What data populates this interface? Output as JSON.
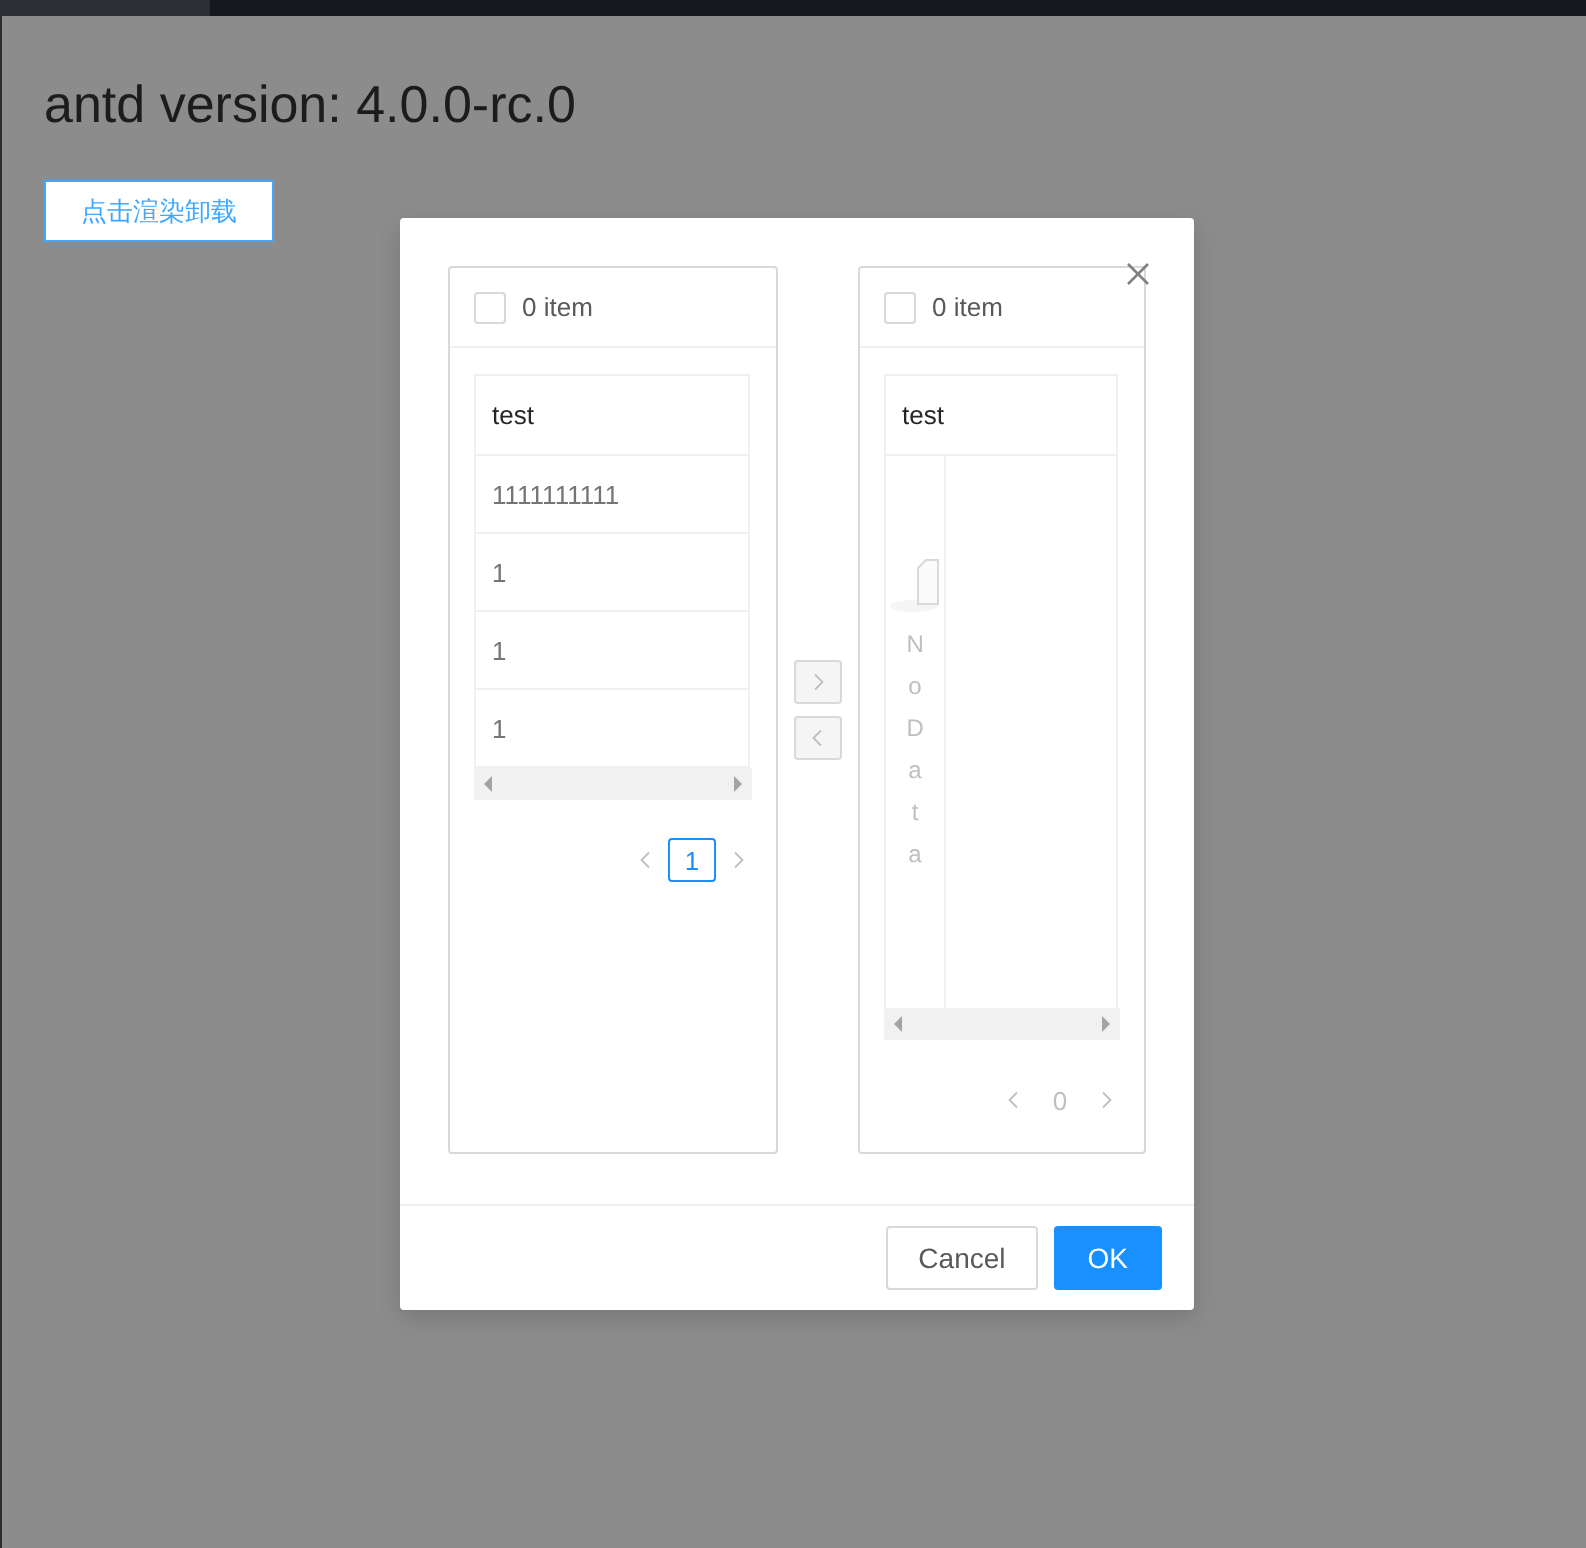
{
  "page": {
    "heading": "antd version: 4.0.0-rc.0",
    "button": "点击渲染卸载"
  },
  "modal": {
    "lists": [
      {
        "header": {
          "checked": false,
          "count": "0 item"
        },
        "table": {
          "columns": [
            "test"
          ],
          "rows": [
            [
              "1111111111"
            ],
            [
              "1"
            ],
            [
              "1"
            ],
            [
              "1"
            ]
          ]
        },
        "pagination": {
          "pages": [
            {
              "label": "1",
              "selected": true
            }
          ]
        }
      },
      {
        "header": {
          "checked": false,
          "count": "0 item"
        },
        "table": {
          "columns": [
            "test"
          ],
          "empty": "No Data"
        },
        "pagination": {
          "pages": [
            {
              "label": "0",
              "selected": false
            }
          ]
        }
      }
    ],
    "operations": [
      {
        "kind": "right",
        "disabled": true
      },
      {
        "kind": "left",
        "disabled": true
      }
    ],
    "footer": [
      {
        "label": "Cancel",
        "kind": "default"
      },
      {
        "label": "OK",
        "kind": "primary"
      }
    ]
  }
}
